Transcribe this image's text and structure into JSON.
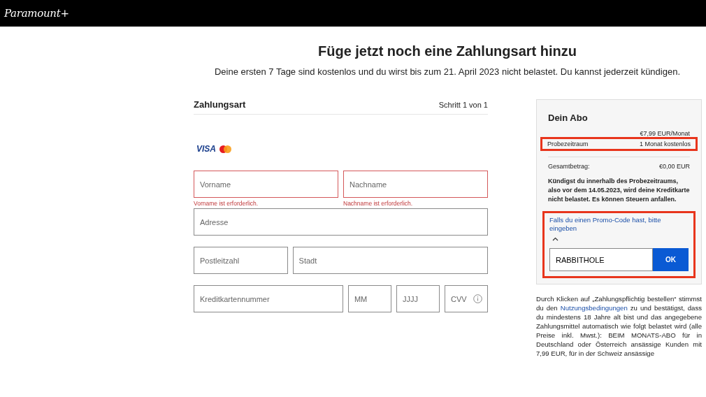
{
  "header": {
    "logo": "Paramount+"
  },
  "title": "Füge jetzt noch eine Zahlungsart hinzu",
  "subtitle": "Deine ersten 7 Tage sind kostenlos und du wirst bis zum 21. April 2023 nicht belastet. Du kannst jederzeit kündigen.",
  "payment": {
    "heading": "Zahlungsart",
    "step": "Schritt 1 von 1",
    "card_logo": "VISA",
    "rows": [
      [
        {
          "placeholder": "Vorname",
          "error": "Vorname ist erforderlich.",
          "kind": "half"
        },
        {
          "placeholder": "Nachname",
          "error": "Nachname ist erforderlich.",
          "kind": "half"
        }
      ],
      [
        {
          "placeholder": "Adresse",
          "kind": "full"
        }
      ],
      [
        {
          "placeholder": "Postleitzahl",
          "kind": "zip"
        },
        {
          "placeholder": "Stadt",
          "kind": "city"
        }
      ],
      [
        {
          "placeholder": "Kreditkartennummer",
          "kind": "card"
        },
        {
          "placeholder": "MM",
          "kind": "short"
        },
        {
          "placeholder": "JJJJ",
          "kind": "short"
        },
        {
          "placeholder": "CVV",
          "kind": "short",
          "info": true
        }
      ]
    ]
  },
  "summary": {
    "title": "Dein Abo",
    "price": "€7,99 EUR/Monat",
    "trial": {
      "label": "Probezeitraum",
      "value": "1 Monat kostenlos",
      "highlighted": true
    },
    "total": {
      "label": "Gesamtbetrag:",
      "value": "€0,00 EUR"
    },
    "notice": "Kündigst du innerhalb des Probezeitraums, also vor dem 14.05.2023, wird deine Kreditkarte nicht belastet. Es können Steuern anfallen.",
    "promo": {
      "link": "Falls du einen Promo-Code hast, bitte eingeben",
      "expanded": true,
      "value": "RABBITHOLE",
      "button": "OK",
      "highlighted": true
    }
  },
  "legal": {
    "before": "Durch Klicken auf „Zahlungspflichtig bestellen“ stimmst du den",
    "link": "Nutzungsbedingungen",
    "after": "zu und bestätigst, dass du mindestens 18 Jahre alt bist und das angegebene Zahlungsmittel automatisch wie folgt belastet wird (alle Preise inkl. Mwst.): BEIM MONATS-ABO für in Deutschland oder Österreich ansässige Kunden mit 7,99 EUR, für in der Schweiz ansässige"
  }
}
